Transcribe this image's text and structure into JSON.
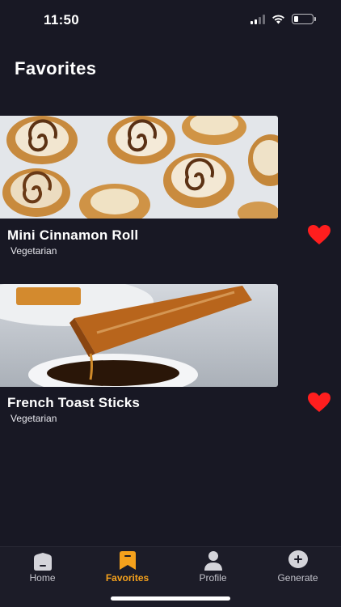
{
  "status": {
    "time": "11:50"
  },
  "header": {
    "title": "Favorites"
  },
  "favorites": [
    {
      "title": "Mini Cinnamon Roll",
      "subtitle": "Vegetarian",
      "favorited": true
    },
    {
      "title": "French Toast Sticks",
      "subtitle": "Vegetarian",
      "favorited": true
    }
  ],
  "tabs": [
    {
      "label": "Home",
      "icon": "home-icon",
      "active": false
    },
    {
      "label": "Favorites",
      "icon": "bookmark-icon",
      "active": true
    },
    {
      "label": "Profile",
      "icon": "person-icon",
      "active": false
    },
    {
      "label": "Generate",
      "icon": "plus-circle-icon",
      "active": false
    }
  ],
  "colors": {
    "background": "#181824",
    "accent": "#f5a11c",
    "heart": "#ff1e1e"
  }
}
